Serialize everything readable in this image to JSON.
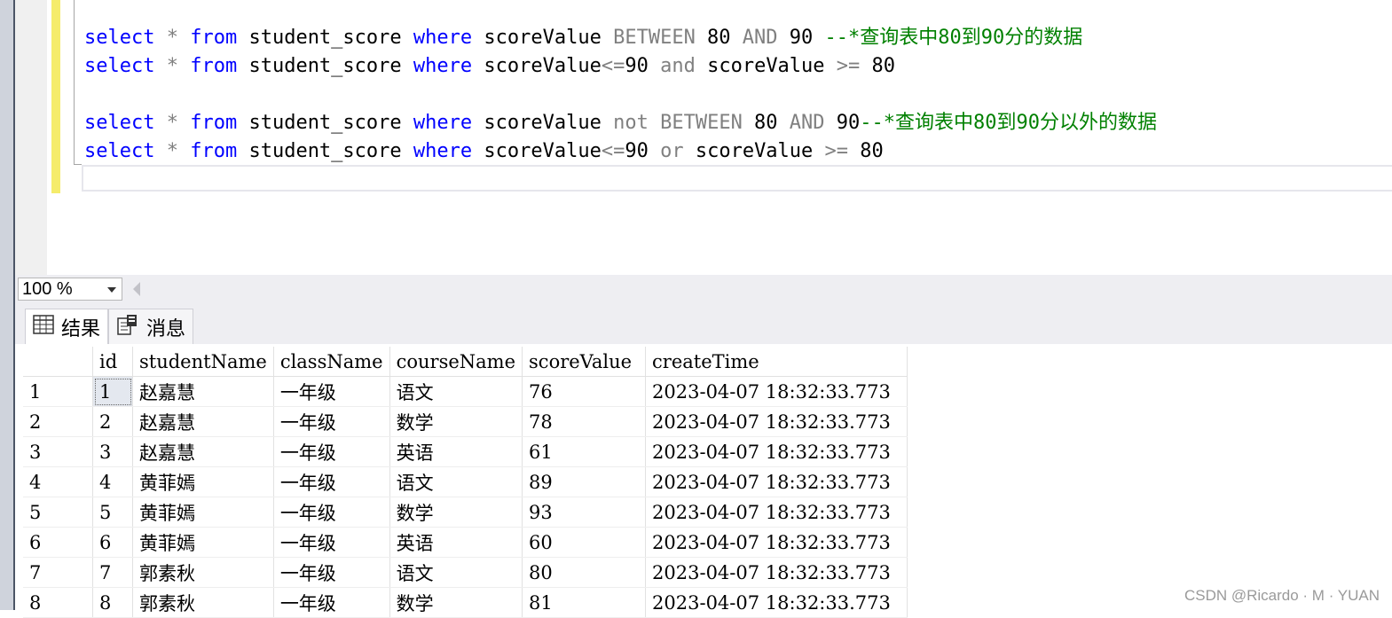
{
  "editor": {
    "lines": [
      [
        {
          "t": "select",
          "c": "kw"
        },
        {
          "t": " "
        },
        {
          "t": "*",
          "c": "op"
        },
        {
          "t": " "
        },
        {
          "t": "from",
          "c": "kw"
        },
        {
          "t": " student_score "
        },
        {
          "t": "where",
          "c": "kw"
        },
        {
          "t": " scoreValue "
        },
        {
          "t": "BETWEEN",
          "c": "op"
        },
        {
          "t": " 80 "
        },
        {
          "t": "AND",
          "c": "op"
        },
        {
          "t": " 90 "
        },
        {
          "t": "--*查询表中80到90分的数据",
          "c": "cm"
        }
      ],
      [
        {
          "t": "select",
          "c": "kw"
        },
        {
          "t": " "
        },
        {
          "t": "*",
          "c": "op"
        },
        {
          "t": " "
        },
        {
          "t": "from",
          "c": "kw"
        },
        {
          "t": " student_score "
        },
        {
          "t": "where",
          "c": "kw"
        },
        {
          "t": " scoreValue"
        },
        {
          "t": "<=",
          "c": "op"
        },
        {
          "t": "90 "
        },
        {
          "t": "and",
          "c": "op"
        },
        {
          "t": " scoreValue "
        },
        {
          "t": ">=",
          "c": "op"
        },
        {
          "t": " 80"
        }
      ],
      [],
      [
        {
          "t": "select",
          "c": "kw"
        },
        {
          "t": " "
        },
        {
          "t": "*",
          "c": "op"
        },
        {
          "t": " "
        },
        {
          "t": "from",
          "c": "kw"
        },
        {
          "t": " student_score "
        },
        {
          "t": "where",
          "c": "kw"
        },
        {
          "t": " scoreValue "
        },
        {
          "t": "not",
          "c": "op"
        },
        {
          "t": " "
        },
        {
          "t": "BETWEEN",
          "c": "op"
        },
        {
          "t": " 80 "
        },
        {
          "t": "AND",
          "c": "op"
        },
        {
          "t": " 90"
        },
        {
          "t": "--*查询表中80到90分以外的数据",
          "c": "cm"
        }
      ],
      [
        {
          "t": "select",
          "c": "kw"
        },
        {
          "t": " "
        },
        {
          "t": "*",
          "c": "op"
        },
        {
          "t": " "
        },
        {
          "t": "from",
          "c": "kw"
        },
        {
          "t": " student_score "
        },
        {
          "t": "where",
          "c": "kw"
        },
        {
          "t": " scoreValue"
        },
        {
          "t": "<=",
          "c": "op"
        },
        {
          "t": "90 "
        },
        {
          "t": "or",
          "c": "op"
        },
        {
          "t": " scoreValue "
        },
        {
          "t": ">=",
          "c": "op"
        },
        {
          "t": " 80"
        }
      ]
    ]
  },
  "statusbar": {
    "zoom": "100 %"
  },
  "tabs": {
    "results": "结果",
    "messages": "消息"
  },
  "grid": {
    "columns": [
      "",
      "id",
      "studentName",
      "className",
      "courseName",
      "scoreValue",
      "createTime"
    ],
    "rows": [
      [
        "1",
        "1",
        "赵嘉慧",
        "一年级",
        "语文",
        "76",
        "2023-04-07 18:32:33.773"
      ],
      [
        "2",
        "2",
        "赵嘉慧",
        "一年级",
        "数学",
        "78",
        "2023-04-07 18:32:33.773"
      ],
      [
        "3",
        "3",
        "赵嘉慧",
        "一年级",
        "英语",
        "61",
        "2023-04-07 18:32:33.773"
      ],
      [
        "4",
        "4",
        "黄菲嫣",
        "一年级",
        "语文",
        "89",
        "2023-04-07 18:32:33.773"
      ],
      [
        "5",
        "5",
        "黄菲嫣",
        "一年级",
        "数学",
        "93",
        "2023-04-07 18:32:33.773"
      ],
      [
        "6",
        "6",
        "黄菲嫣",
        "一年级",
        "英语",
        "60",
        "2023-04-07 18:32:33.773"
      ],
      [
        "7",
        "7",
        "郭素秋",
        "一年级",
        "语文",
        "80",
        "2023-04-07 18:32:33.773"
      ],
      [
        "8",
        "8",
        "郭素秋",
        "一年级",
        "数学",
        "81",
        "2023-04-07 18:32:33.773"
      ]
    ]
  },
  "watermark": "CSDN @Ricardo · M · YUAN",
  "colors": {
    "keyword": "#0000ff",
    "operator": "#808080",
    "comment": "#008000",
    "change_bar": "#f5ec6b"
  }
}
